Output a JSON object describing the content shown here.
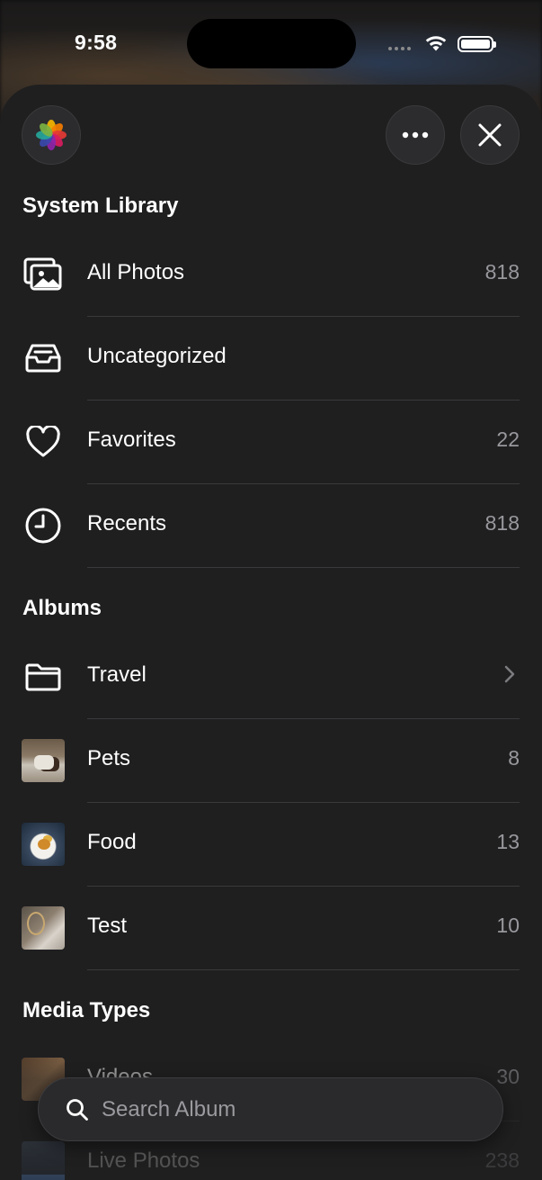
{
  "status_bar": {
    "time": "9:58"
  },
  "header": {
    "app_icon": "photos-app-icon",
    "more_icon": "ellipsis-icon",
    "close_icon": "close-icon"
  },
  "sections": {
    "system_library": {
      "title": "System Library",
      "items": [
        {
          "label": "All Photos",
          "count": "818",
          "icon": "photos-stack-icon"
        },
        {
          "label": "Uncategorized",
          "count": "",
          "icon": "tray-icon"
        },
        {
          "label": "Favorites",
          "count": "22",
          "icon": "heart-icon"
        },
        {
          "label": "Recents",
          "count": "818",
          "icon": "clock-icon"
        }
      ]
    },
    "albums": {
      "title": "Albums",
      "items": [
        {
          "label": "Travel",
          "count": "",
          "icon": "folder-icon"
        },
        {
          "label": "Pets",
          "count": "8"
        },
        {
          "label": "Food",
          "count": "13"
        },
        {
          "label": "Test",
          "count": "10"
        }
      ]
    },
    "media_types": {
      "title": "Media Types",
      "items": [
        {
          "label": "Videos",
          "count": "30"
        },
        {
          "label": "Live Photos",
          "count": "238"
        }
      ]
    }
  },
  "search": {
    "placeholder": "Search Album",
    "value": ""
  },
  "colors": {
    "sheet_bg": "#1f1f20",
    "secondary_text": "#98989d",
    "divider": "#3a3a3c"
  }
}
